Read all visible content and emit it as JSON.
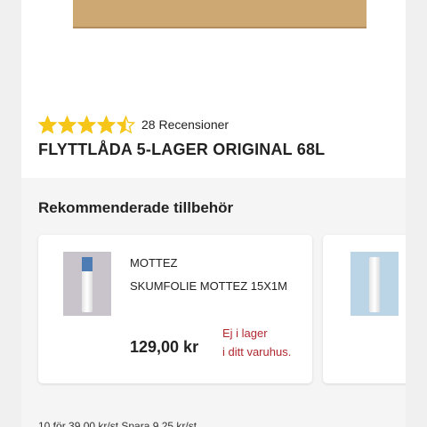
{
  "product": {
    "rating": 4.5,
    "max_rating": 5,
    "review_count_label": "28 Recensioner",
    "title": "FLYTTLÅDA 5-LAGER ORIGINAL 68L",
    "star_color": "#f5c518"
  },
  "accessories": {
    "section_title": "Rekommenderade tillbehör",
    "items": [
      {
        "brand": "MOTTEZ",
        "name": "SKUMFOLIE MOTTEZ 15X1M",
        "price": "129,00 kr",
        "stock_line1": "Ej i lager",
        "stock_line2": "i ditt varuhus."
      }
    ]
  },
  "footer": {
    "partial_text": "10 för 39,00 kr/st  Spara 9,25 kr/st"
  },
  "colors": {
    "stock_status": "#b0282f",
    "page_background": "#f0f0f0"
  }
}
